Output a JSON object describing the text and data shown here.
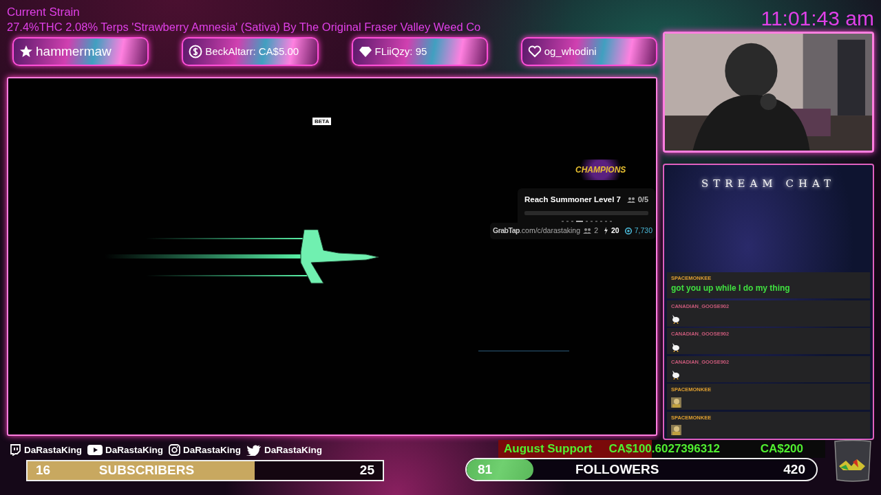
{
  "strain": {
    "heading": "Current Strain",
    "text": "27.4%THC 2.08% Terps 'Strawberry Amnesia' (Sativa) By The Original Fraser Valley Weed Co"
  },
  "clock": "11:01:43 am",
  "alerts": [
    {
      "kind": "star",
      "text": "hammermaw"
    },
    {
      "kind": "dollar",
      "text": "BeckAltarr: CA$5.00"
    },
    {
      "kind": "diamond",
      "text": "FLiiQzy: 95"
    },
    {
      "kind": "heart",
      "text": "og_whodini"
    }
  ],
  "game": {
    "badge": "BETA",
    "logo": "CHAMPIONS",
    "challenge": {
      "title": "Reach Summoner Level 7",
      "count": "0/5",
      "level": 0,
      "pages": [
        false,
        false,
        false,
        true,
        false,
        false,
        false,
        false,
        false,
        false
      ]
    },
    "footer": {
      "brand": "GrabTap",
      "link": ".com/c/darastaking",
      "viewers": "2",
      "boost": "20",
      "coins": "7,730"
    }
  },
  "chat": {
    "title": "STREAM CHAT",
    "messages": [
      {
        "user": "SPACEMONKEE",
        "color": "#e0a030",
        "kind": "text",
        "text": "got you up while I do my thing"
      },
      {
        "user": "CANADIAN_GOOSE902",
        "color": "#c85a7a",
        "kind": "goose"
      },
      {
        "user": "CANADIAN_GOOSE902",
        "color": "#c85a7a",
        "kind": "goose"
      },
      {
        "user": "CANADIAN_GOOSE902",
        "color": "#c85a7a",
        "kind": "goose"
      },
      {
        "user": "SPACEMONKEE",
        "color": "#e0a030",
        "kind": "picture"
      },
      {
        "user": "SPACEMONKEE",
        "color": "#e0a030",
        "kind": "picture"
      }
    ]
  },
  "socials": [
    {
      "kind": "twitch",
      "text": "DaRastaKing"
    },
    {
      "kind": "youtube",
      "text": "DaRastaKing"
    },
    {
      "kind": "instagram",
      "text": "DaRastaKing"
    },
    {
      "kind": "twitter",
      "text": "DaRastaKing"
    }
  ],
  "subscribers": {
    "current": "16",
    "label": "SUBSCRIBERS",
    "goal": "25",
    "level": 0.64
  },
  "support": {
    "label": "August Support",
    "amount": "CA$100.6027396312",
    "goal": "CA$200",
    "level": 0.47
  },
  "followers": {
    "current": "81",
    "label": "FOLLOWERS",
    "goal": "420",
    "level": 0.19
  }
}
